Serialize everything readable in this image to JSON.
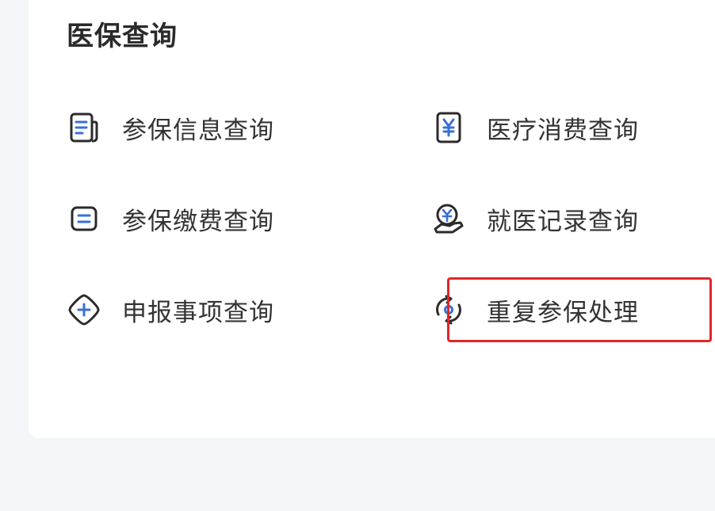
{
  "section": {
    "title": "医保查询"
  },
  "items": [
    {
      "label": "参保信息查询",
      "icon": "document-list-icon"
    },
    {
      "label": "医疗消费查询",
      "icon": "yuan-receipt-icon"
    },
    {
      "label": "参保缴费查询",
      "icon": "payment-record-icon"
    },
    {
      "label": "就医记录查询",
      "icon": "yuan-hand-icon"
    },
    {
      "label": "申报事项查询",
      "icon": "plus-diamond-icon"
    },
    {
      "label": "重复参保处理",
      "icon": "refresh-cycle-icon"
    }
  ],
  "colors": {
    "icon_stroke": "#2b2b2b",
    "icon_accent": "#3a6fd8",
    "highlight": "#e0262a",
    "page_background": "#f4f5f9",
    "card_background": "#ffffff"
  }
}
